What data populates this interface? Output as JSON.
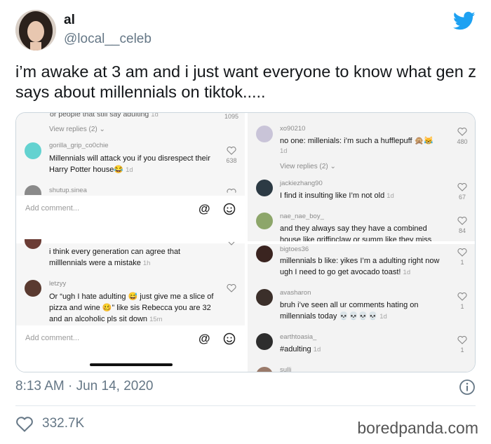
{
  "tweet": {
    "display_name": "al",
    "handle": "@local__celeb",
    "text": "i’m awake at 3 am and i just want everyone to know what gen z says about millennials on tiktok.....",
    "timestamp": "8:13 AM · Jun 14, 2020",
    "likes": "332.7K"
  },
  "watermark": "boredpanda.com",
  "screenshot_left": {
    "top_cut_text": "or people that still say  adulting",
    "top_cut_time": "1d",
    "top_cut_likes": "1095",
    "view_replies_1": "View replies (2)",
    "comments": [
      {
        "user": "gorilla_grip_co0chie",
        "text": "Millennials will attack you if you disrespect their Harry Potter house😂",
        "time": "1d",
        "likes": "638"
      },
      {
        "user": "shutup.sinea",
        "text": "",
        "time": "",
        "likes": ""
      },
      {
        "user": "",
        "text": "i think every generation can agree that milllennials were a mistake",
        "time": "1h",
        "likes": ""
      },
      {
        "user": "letzyy",
        "text": "Or “ugh I hate adulting 😅 just give me a slice of pizza and wine 🥴” like sis Rebecca you are 32 and an alcoholic pls sit down",
        "time": "15m",
        "likes": ""
      }
    ],
    "comment_placeholder": "Add comment...",
    "at_symbol": "@"
  },
  "screenshot_right": {
    "comments": [
      {
        "user": "xo90210",
        "text": "no one: millenials: i’m such a hufflepuff 🙊😹",
        "time": "1d",
        "likes": "480"
      },
      {
        "user": "jackiezhang90",
        "text": "I find it insulting like I’m not old",
        "time": "1d",
        "likes": "67"
      },
      {
        "user": "nae_nae_boy_",
        "text": "and they always say they have a combined house like griffinclaw or summ like they miss",
        "time": "",
        "likes": "84"
      },
      {
        "user": "bigtoes36",
        "text": "millennials b like: yikes I’m a  adulting right now ugh I need to go get avocado toast!",
        "time": "1d",
        "likes": "1"
      },
      {
        "user": "avasharon",
        "text": "bruh i’ve seen all ur comments hating on millennials today 💀💀💀💀",
        "time": "1d",
        "likes": "1"
      },
      {
        "user": "earthtoasia_",
        "text": "#adulting",
        "time": "1d",
        "likes": "1"
      },
      {
        "user": "sulli",
        "text": "",
        "time": "",
        "likes": ""
      }
    ],
    "view_replies": "View replies (2)"
  },
  "colors": {
    "twitter_blue": "#1da1f2",
    "secondary_text": "#657786"
  }
}
